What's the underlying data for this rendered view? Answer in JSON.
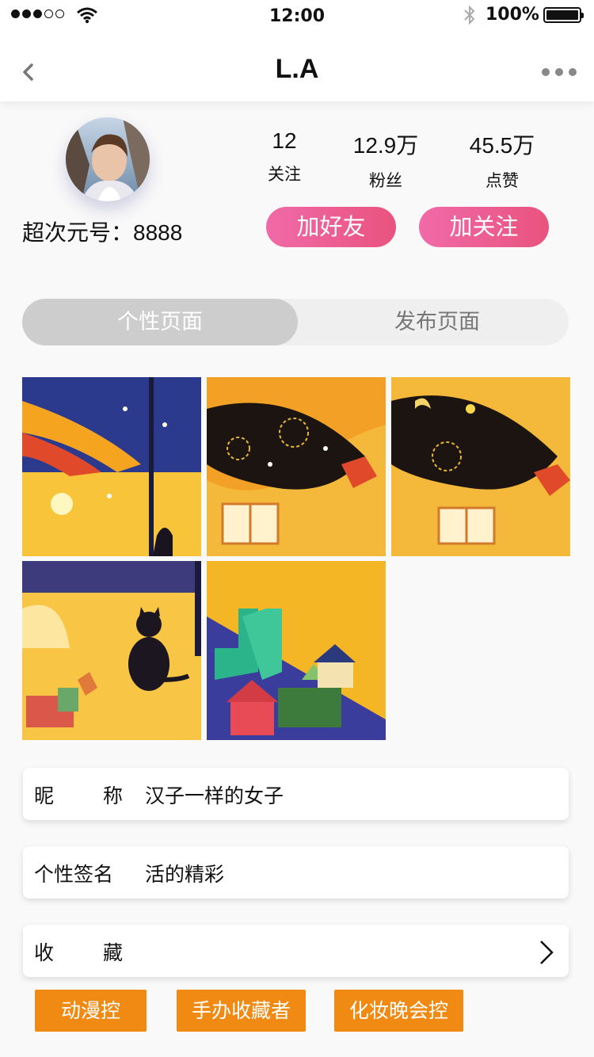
{
  "status": {
    "time": "12:00",
    "battery": "100%"
  },
  "nav": {
    "title": "L.A"
  },
  "profile": {
    "uid_label": "超次元号：",
    "uid": "8888",
    "stats": [
      {
        "num": "12",
        "label": "关注"
      },
      {
        "num": "12.9万",
        "label": "粉丝"
      },
      {
        "num": "45.5万",
        "label": "点赞"
      }
    ],
    "add_friend": "加好友",
    "follow": "加关注"
  },
  "tabs": {
    "active": "个性页面",
    "other": "发布页面"
  },
  "gallery": [
    "illustration-girl-cat",
    "illustration-starry-hair",
    "illustration-starry-hair-moon",
    "illustration-black-cat",
    "illustration-boots-houses"
  ],
  "info": {
    "nickname_k1": "昵",
    "nickname_k2": "称",
    "nickname": "汉子一样的女子",
    "signature_k": "个性签名",
    "signature": "活的精彩",
    "fav_k1": "收",
    "fav_k2": "藏"
  },
  "tags": [
    "动漫控",
    "手办收藏者",
    "化妆晚会控"
  ],
  "colors": {
    "accent_pink": "#ec5f93",
    "tag_orange": "#f08a12"
  }
}
